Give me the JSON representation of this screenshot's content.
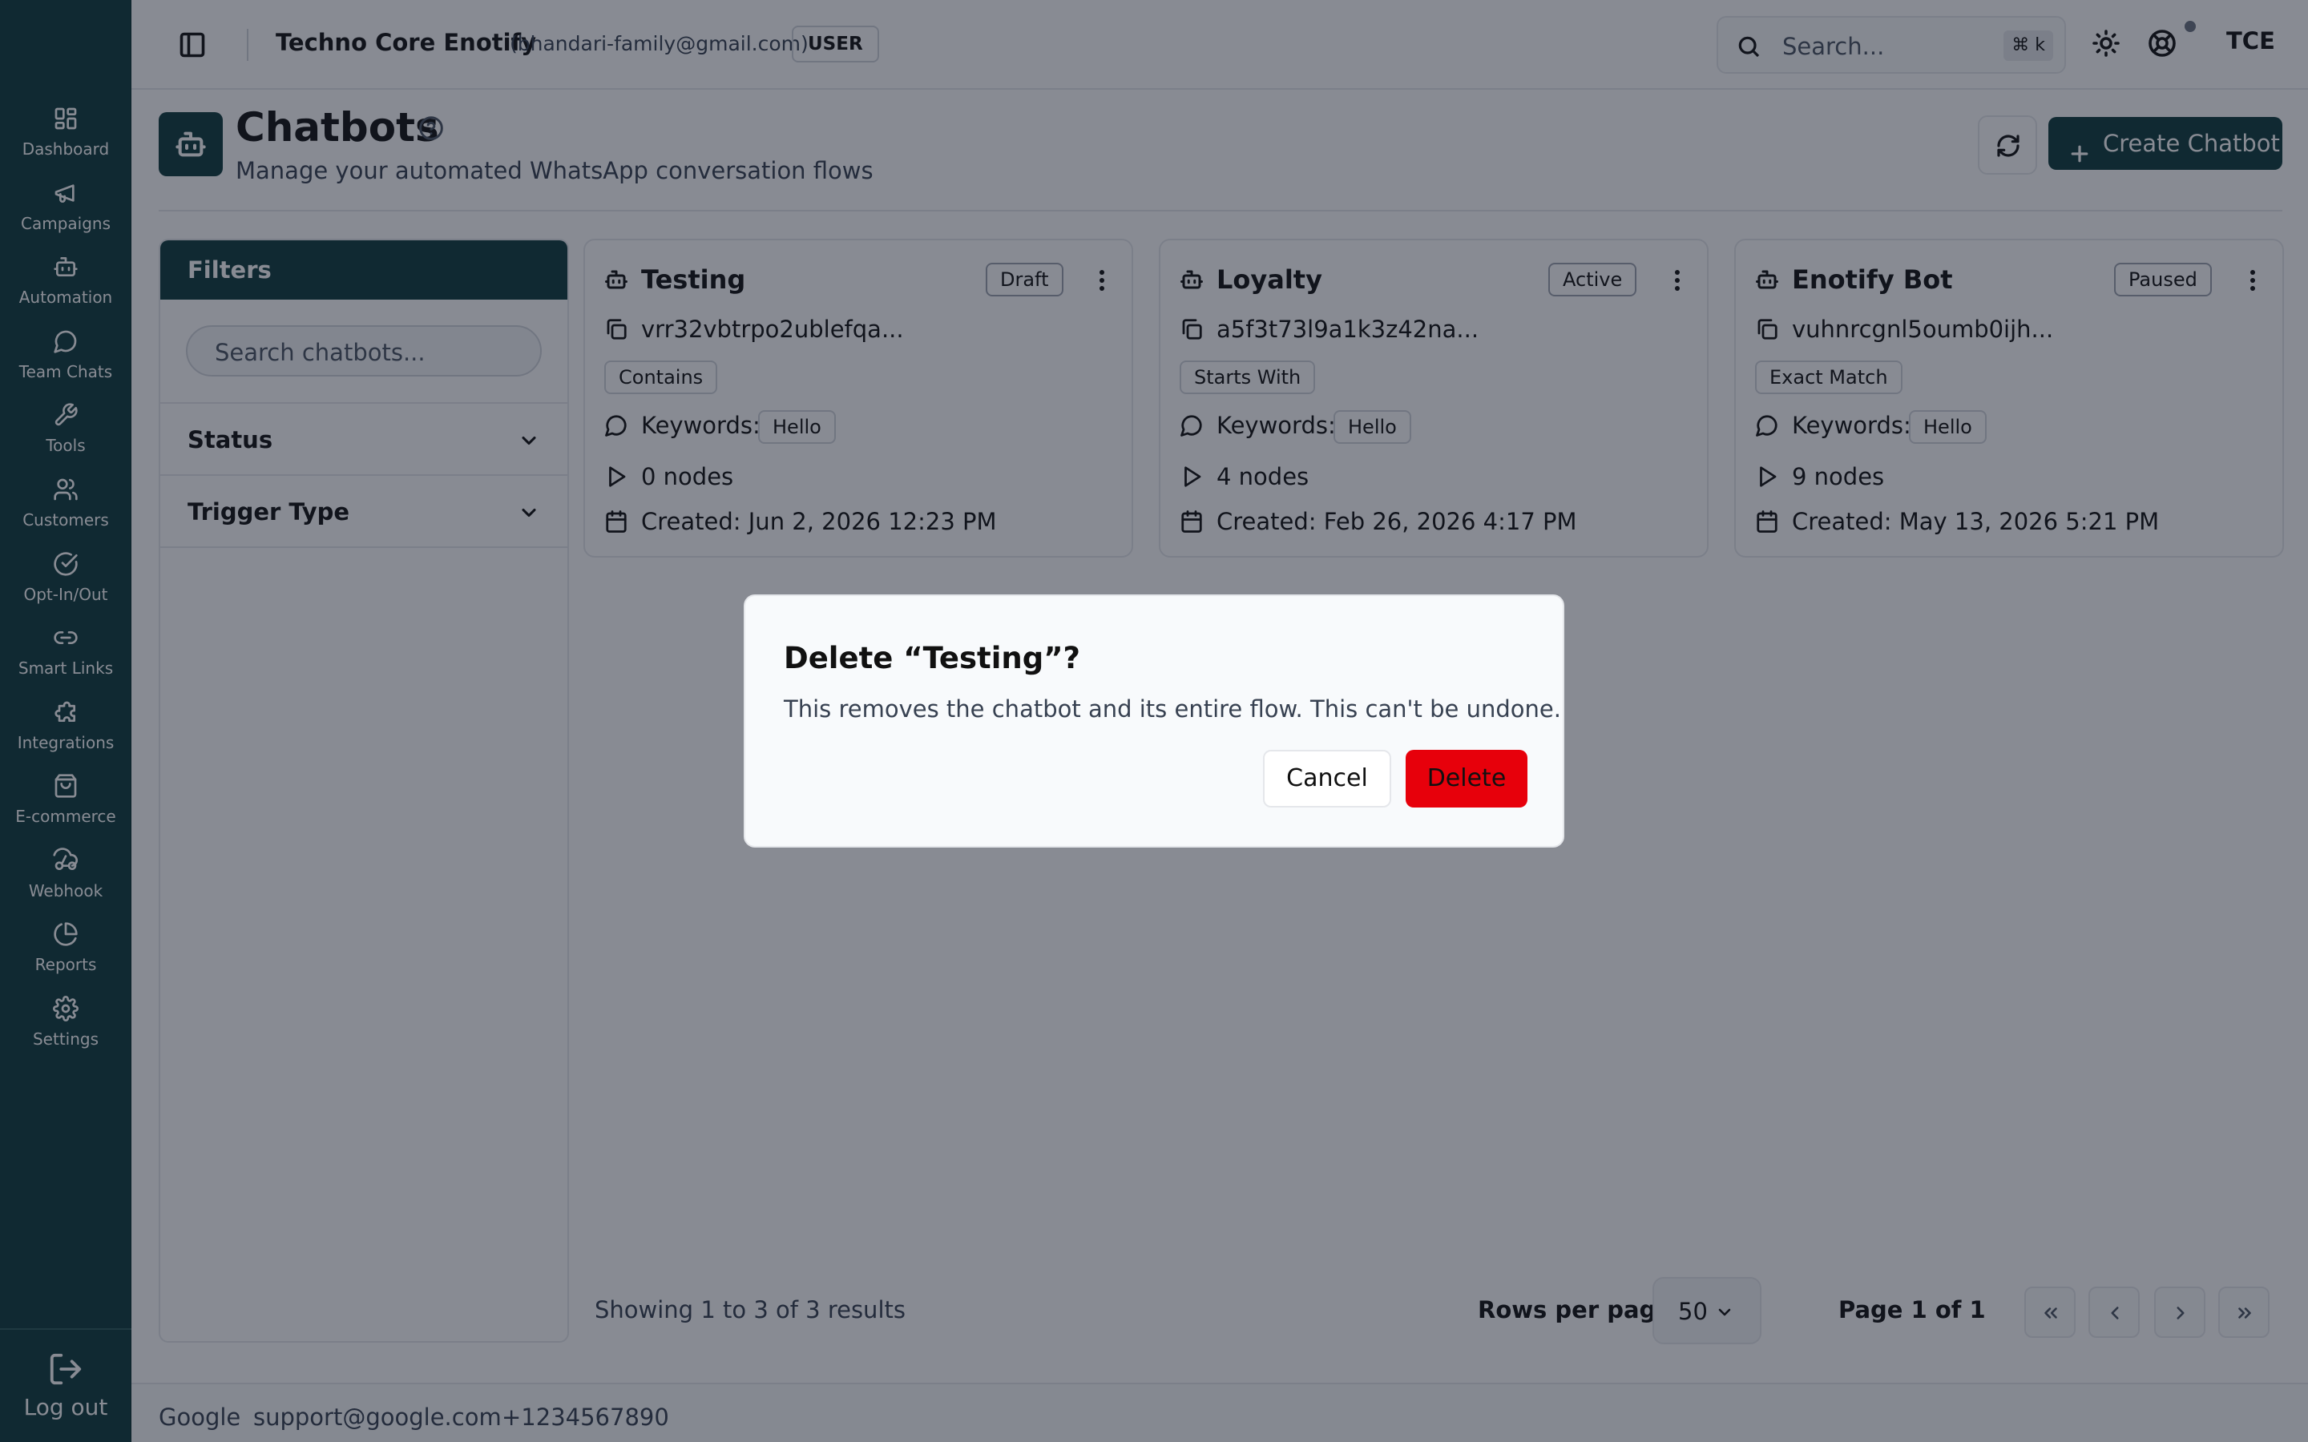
{
  "sidebar": {
    "items": [
      {
        "label": "Dashboard",
        "icon": "dashboard-icon"
      },
      {
        "label": "Campaigns",
        "icon": "megaphone-icon"
      },
      {
        "label": "Automation",
        "icon": "bot-icon"
      },
      {
        "label": "Team Chats",
        "icon": "chat-icon"
      },
      {
        "label": "Tools",
        "icon": "wrench-icon"
      },
      {
        "label": "Customers",
        "icon": "users-icon"
      },
      {
        "label": "Opt-In/Out",
        "icon": "check-circle-icon"
      },
      {
        "label": "Smart Links",
        "icon": "link-icon"
      },
      {
        "label": "Integrations",
        "icon": "puzzle-icon"
      },
      {
        "label": "E-commerce",
        "icon": "shopping-bag-icon"
      },
      {
        "label": "Webhook",
        "icon": "webhook-icon"
      },
      {
        "label": "Reports",
        "icon": "pie-chart-icon"
      },
      {
        "label": "Settings",
        "icon": "gear-icon"
      }
    ],
    "logout_label": "Log out"
  },
  "header": {
    "org_name": "Techno Core Enotify",
    "email": "(bhandari-family@gmail.com)",
    "role": "USER",
    "search_placeholder": "Search...",
    "search_shortcut": "⌘ k",
    "avatar_initials": "TCE"
  },
  "page": {
    "title": "Chatbots",
    "subtitle": "Manage your automated WhatsApp conversation flows",
    "create_label": "Create Chatbot"
  },
  "filters": {
    "title": "Filters",
    "search_placeholder": "Search chatbots...",
    "status_label": "Status",
    "trigger_label": "Trigger Type"
  },
  "cards": [
    {
      "name": "Testing",
      "status": "Draft",
      "id": "vrr32vbtrpo2ublefqa...",
      "trigger": "Contains",
      "keywords_label": "Keywords:",
      "keyword": "Hello",
      "nodes": "0 nodes",
      "created": "Created: Jun 2, 2026 12:23 PM"
    },
    {
      "name": "Loyalty",
      "status": "Active",
      "id": "a5f3t73l9a1k3z42na...",
      "trigger": "Starts With",
      "keywords_label": "Keywords:",
      "keyword": "Hello",
      "nodes": "4 nodes",
      "created": "Created: Feb 26, 2026 4:17 PM"
    },
    {
      "name": "Enotify Bot",
      "status": "Paused",
      "id": "vuhnrcgnl5oumb0ijh...",
      "trigger": "Exact Match",
      "keywords_label": "Keywords:",
      "keyword": "Hello",
      "nodes": "9 nodes",
      "created": "Created: May 13, 2026 5:21 PM"
    }
  ],
  "pagination": {
    "showing": "Showing 1 to 3 of 3 results",
    "rows_per_page_label": "Rows per page",
    "rows_per_page_value": "50",
    "page_of": "Page 1 of 1"
  },
  "footer": {
    "company": "Google",
    "email": "support@google.com",
    "phone": "+1234567890"
  },
  "dialog": {
    "title": "Delete “Testing”?",
    "description": "This removes the chatbot and its entire flow. This can't be undone.",
    "cancel_label": "Cancel",
    "delete_label": "Delete"
  },
  "colors": {
    "brand": "#0e3b3c",
    "danger": "#e7000b"
  }
}
